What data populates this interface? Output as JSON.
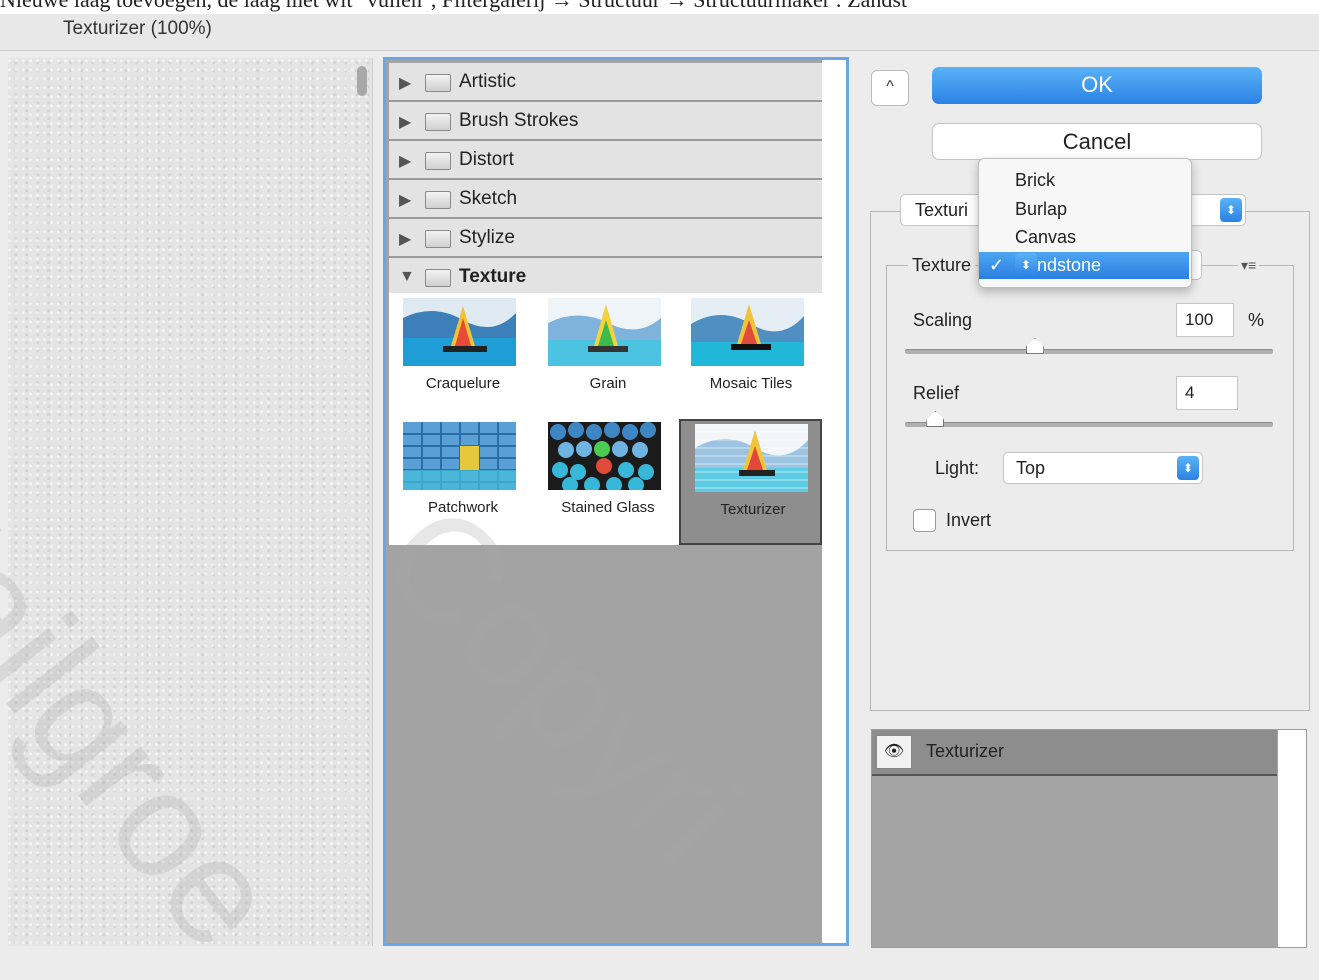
{
  "caption_text": "Nieuwe laag toevoegen, de laag met wit \"vullen\", Filtergalerij → Structuur → Structuurmaker : Zandst",
  "window": {
    "title": "Texturizer (100%)"
  },
  "categories": [
    {
      "label": "Artistic",
      "open": false
    },
    {
      "label": "Brush Strokes",
      "open": false
    },
    {
      "label": "Distort",
      "open": false
    },
    {
      "label": "Sketch",
      "open": false
    },
    {
      "label": "Stylize",
      "open": false
    },
    {
      "label": "Texture",
      "open": true
    }
  ],
  "thumbnails": [
    {
      "label": "Craquelure"
    },
    {
      "label": "Grain"
    },
    {
      "label": "Mosaic Tiles"
    },
    {
      "label": "Patchwork"
    },
    {
      "label": "Stained Glass"
    },
    {
      "label": "Texturizer",
      "selected": true
    }
  ],
  "buttons": {
    "collapse_icon": "^",
    "ok": "OK",
    "cancel": "Cancel"
  },
  "filter_select": {
    "value": "Texturi"
  },
  "texture_section": {
    "label": "Texture",
    "options": [
      "Brick",
      "Burlap",
      "Canvas",
      "Sandstone"
    ],
    "selected": "Sandstone",
    "check_mark": "✓",
    "menu_icon": "▾≡"
  },
  "scaling": {
    "label": "Scaling",
    "value": "100",
    "unit": "%",
    "level": 0.35
  },
  "relief": {
    "label": "Relief",
    "value": "4",
    "level": 0.08
  },
  "light": {
    "label": "Light:",
    "value": "Top"
  },
  "invert": {
    "label": "Invert",
    "checked": false
  },
  "layers": {
    "name": "Texturizer",
    "eye_icon": "👁"
  },
  "stepper_glyph": "⬍",
  "colors": {
    "accent": "#2b82e4",
    "panel": "#ececec",
    "gallery_bg": "#a3a3a3"
  }
}
